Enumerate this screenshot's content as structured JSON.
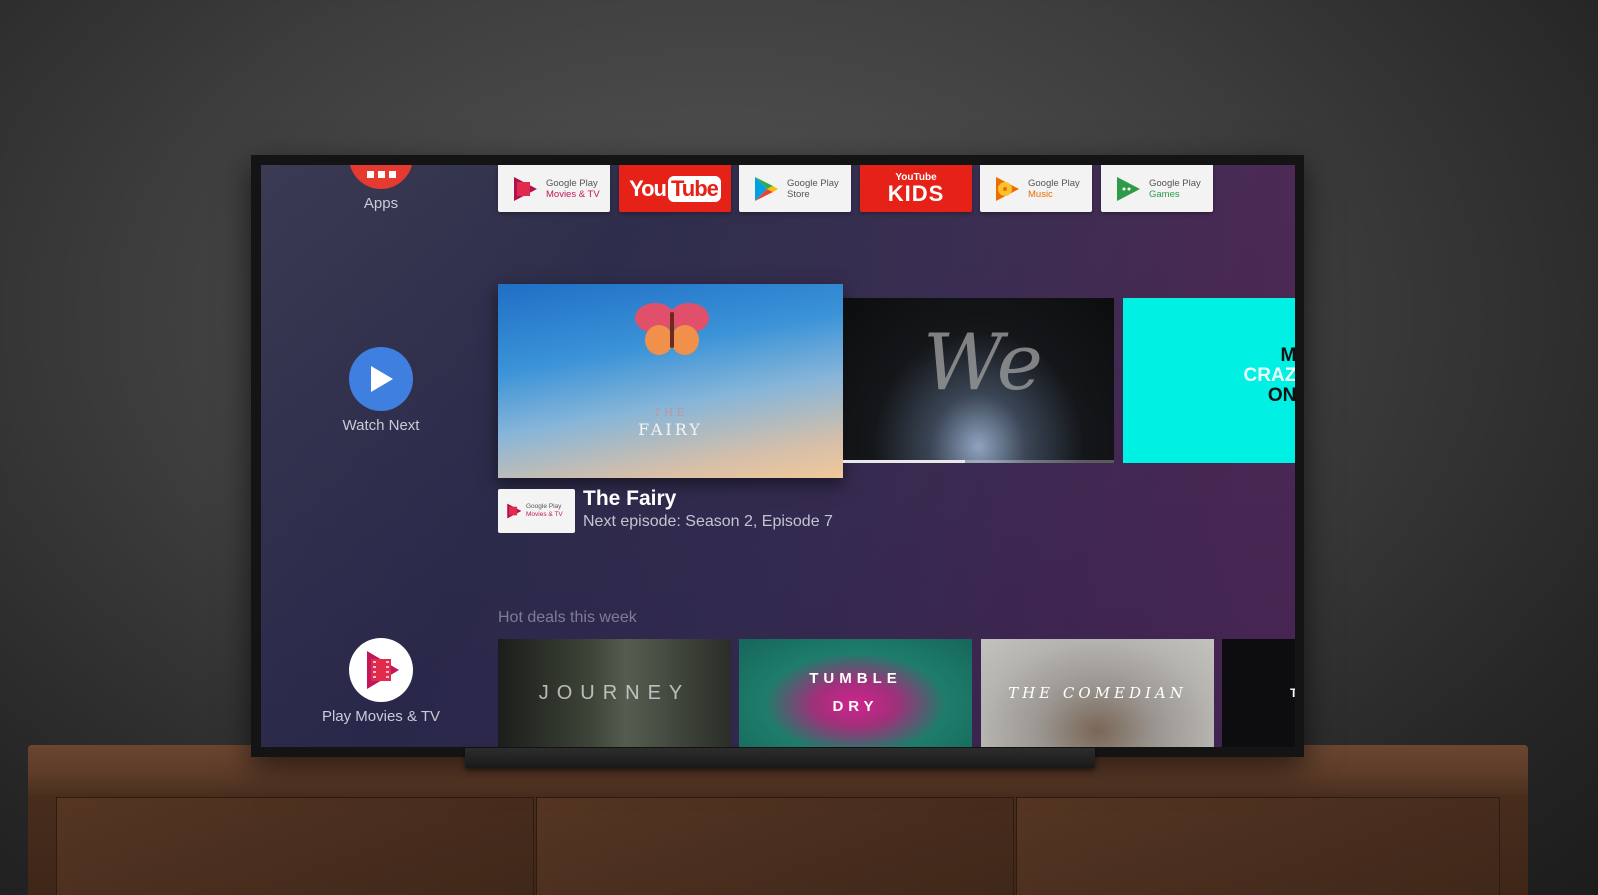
{
  "sidebar": {
    "items": [
      {
        "label": "Apps",
        "icon": "apps-grid-icon",
        "color": "#e53a2f"
      },
      {
        "label": "Watch Next",
        "icon": "play-icon",
        "color": "#3f7fe0"
      },
      {
        "label": "Play Movies & TV",
        "icon": "play-movies-icon",
        "color": "#ffffff"
      }
    ]
  },
  "apps": [
    {
      "name": "Google Play",
      "sub": "Movies & TV",
      "sub_color": "#c2185b"
    },
    {
      "name": "YouTube",
      "brand_left": "You",
      "brand_right": "Tube"
    },
    {
      "name": "Google Play",
      "sub": "Store",
      "sub_color": "#666666"
    },
    {
      "name": "YouTube Kids",
      "brand_top": "YouTube",
      "brand_main": "KIDS"
    },
    {
      "name": "Google Play",
      "sub": "Music",
      "sub_color": "#ef6c00"
    },
    {
      "name": "Google Play",
      "sub": "Games",
      "sub_color": "#2e9b48"
    }
  ],
  "watch_next": {
    "items": [
      {
        "title": "The Fairy",
        "poster_the": "THE",
        "poster_title": "FAIRY"
      },
      {
        "title": "We",
        "poster_title": "We",
        "progress": 0.45
      },
      {
        "title": "My Crazy One",
        "poster_lines": [
          "MY",
          "CRAZY",
          "ONE"
        ]
      }
    ],
    "focused": {
      "title": "The Fairy",
      "subtitle": "Next episode: Season 2, Episode 7",
      "provider_name": "Google Play",
      "provider_sub": "Movies & TV"
    }
  },
  "hot_deals": {
    "title": "Hot deals this week",
    "items": [
      {
        "title": "JOURNEY"
      },
      {
        "title_line1": "TUMBLE",
        "title_line2": "DRY"
      },
      {
        "title": "THE COMEDIAN"
      },
      {
        "title": "TH"
      }
    ]
  }
}
